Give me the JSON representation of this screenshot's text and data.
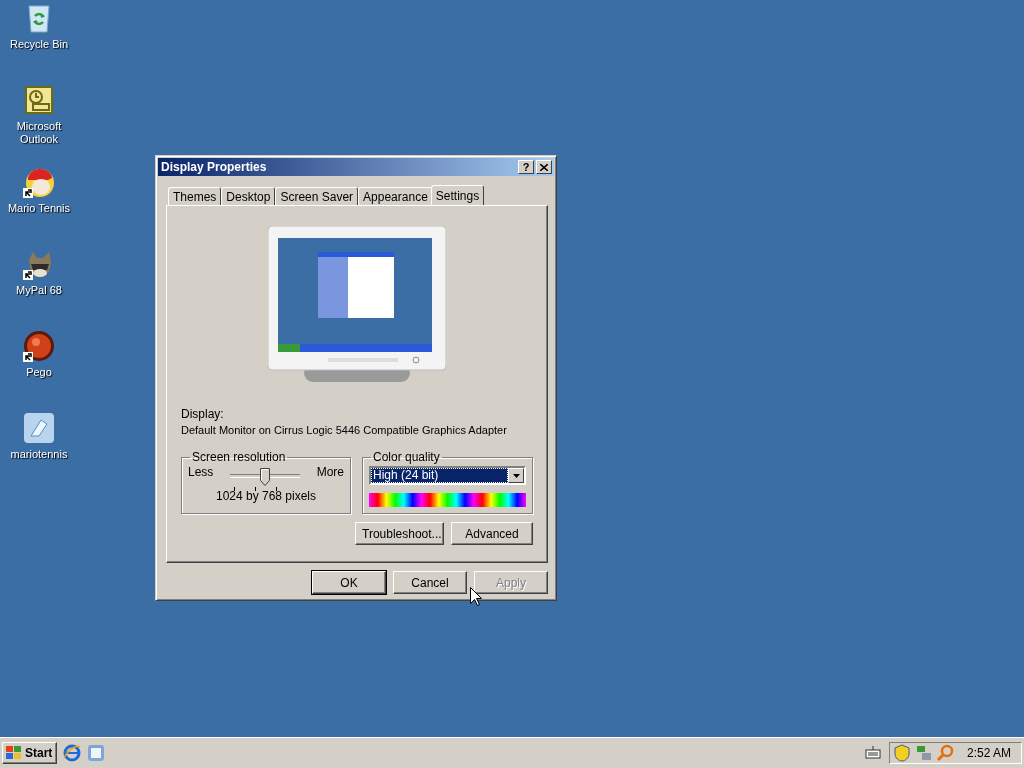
{
  "desktop_icons": [
    {
      "label": "Recycle Bin",
      "kind": "recycle",
      "shortcut": false
    },
    {
      "label": "Microsoft Outlook",
      "kind": "outlook",
      "shortcut": false
    },
    {
      "label": "Mario Tennis",
      "kind": "game",
      "shortcut": true
    },
    {
      "label": "MyPal 68",
      "kind": "raccoon",
      "shortcut": true
    },
    {
      "label": "Pego",
      "kind": "orb",
      "shortcut": true
    },
    {
      "label": "mariotennis",
      "kind": "app",
      "shortcut": false
    }
  ],
  "dialog": {
    "title": "Display Properties",
    "help": "?",
    "tabs": [
      {
        "label": "Themes",
        "selected": false
      },
      {
        "label": "Desktop",
        "selected": false
      },
      {
        "label": "Screen Saver",
        "selected": false
      },
      {
        "label": "Appearance",
        "selected": false
      },
      {
        "label": "Settings",
        "selected": true
      }
    ],
    "display_label": "Display:",
    "display_name": "Default Monitor on Cirrus Logic 5446 Compatible Graphics Adapter",
    "screen_resolution": {
      "title": "Screen resolution",
      "less": "Less",
      "more": "More",
      "level": 0.5,
      "reading": "1024 by 768 pixels"
    },
    "color_quality": {
      "title": "Color quality",
      "value": "High (24 bit)"
    },
    "panel_buttons": [
      "Troubleshoot...",
      "Advanced"
    ],
    "buttons": [
      {
        "label": "OK",
        "disabled": false,
        "default": true
      },
      {
        "label": "Cancel",
        "disabled": false,
        "default": false
      },
      {
        "label": "Apply",
        "disabled": true,
        "default": false
      }
    ]
  },
  "taskbar": {
    "start": "Start",
    "clock": "2:52 AM"
  }
}
